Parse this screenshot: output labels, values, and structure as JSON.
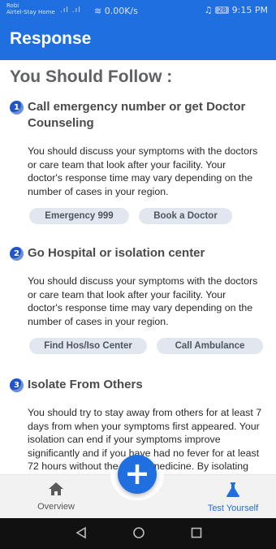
{
  "status_bar": {
    "carrier_line1": "Robi",
    "carrier_line2": "Airtel-Stay Home",
    "signal": ".ıl .ıl",
    "net_speed": "0.00K/s",
    "battery": "28",
    "time": "9:15 PM"
  },
  "app_bar": {
    "title": "Response"
  },
  "main": {
    "heading": "You Should Follow :",
    "sections": [
      {
        "number": "1",
        "title": "Call emergency number or get Doctor Counseling",
        "body": "You should discuss your symptoms with the doctors or care team that look after your facility. Your doctor's response time may vary depending on the number of cases in your region.",
        "buttons": [
          "Emergency 999",
          "Book a Doctor"
        ]
      },
      {
        "number": "2",
        "title": "Go Hospital or isolation center",
        "body": "You should discuss your symptoms with the doctors or care team that look after your facility. Your doctor's response time may vary depending on the number of cases in your region.",
        "buttons": [
          "Find Hos/Iso Center",
          "Call Ambulance"
        ]
      },
      {
        "number": "3",
        "title": "Isolate From Others",
        "body": "You should try to stay away from others for at least 7 days from when your symptoms first appeared. Your isolation can end if your symptoms improve significantly and if you have had no fever for at least 72 hours without the use of medicine. By isolating yourself, you can slow the spread of"
      }
    ]
  },
  "bottom_nav": {
    "items": [
      {
        "label": "Overview",
        "icon": "home-icon",
        "active": false
      },
      {
        "label": "Test Yourself",
        "icon": "flask-icon",
        "active": true
      }
    ],
    "fab_icon": "plus-icon"
  },
  "colors": {
    "primary": "#1f6fe0",
    "heading_gray": "#5f6163",
    "pill_bg": "#e2e6ef",
    "active_nav": "#1f6fe0"
  }
}
